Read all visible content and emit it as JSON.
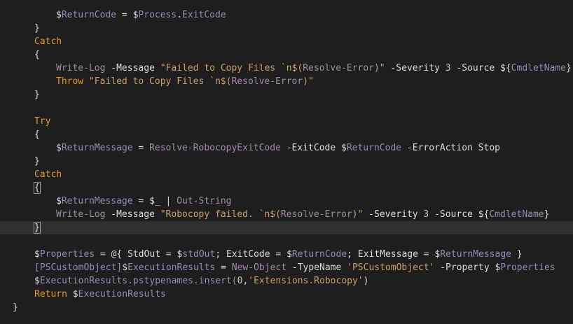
{
  "lines": [
    {
      "indent": 80,
      "tokens": [
        {
          "t": "$",
          "c": "pl"
        },
        {
          "t": "ReturnCode",
          "c": "var"
        },
        {
          "t": " = ",
          "c": "pl"
        },
        {
          "t": "$",
          "c": "pl"
        },
        {
          "t": "Process",
          "c": "var"
        },
        {
          "t": ".",
          "c": "pl"
        },
        {
          "t": "ExitCode",
          "c": "var"
        }
      ]
    },
    {
      "indent": 49,
      "tokens": [
        {
          "t": "}",
          "c": "pl"
        }
      ]
    },
    {
      "indent": 49,
      "tokens": [
        {
          "t": "Catch",
          "c": "kw"
        }
      ]
    },
    {
      "indent": 49,
      "tokens": [
        {
          "t": "{",
          "c": "pl"
        }
      ]
    },
    {
      "indent": 80,
      "tokens": [
        {
          "t": "Write-Log",
          "c": "cmd"
        },
        {
          "t": " -Message ",
          "c": "prm"
        },
        {
          "t": "\"Failed to Copy Files `n$(",
          "c": "str"
        },
        {
          "t": "Resolve-Error",
          "c": "cmd"
        },
        {
          "t": ")\"",
          "c": "str"
        },
        {
          "t": " -Severity ",
          "c": "prm"
        },
        {
          "t": "3",
          "c": "num"
        },
        {
          "t": " -Source ",
          "c": "prm"
        },
        {
          "t": "${",
          "c": "pl"
        },
        {
          "t": "CmdletName",
          "c": "var"
        },
        {
          "t": "}",
          "c": "pl"
        }
      ]
    },
    {
      "indent": 80,
      "tokens": [
        {
          "t": "Throw",
          "c": "kw"
        },
        {
          "t": " \"Failed to Copy Files `n$(",
          "c": "str"
        },
        {
          "t": "Resolve-Error",
          "c": "cmd"
        },
        {
          "t": ")\"",
          "c": "str"
        }
      ]
    },
    {
      "indent": 49,
      "tokens": [
        {
          "t": "}",
          "c": "pl"
        }
      ]
    },
    {
      "indent": 49,
      "tokens": []
    },
    {
      "indent": 49,
      "tokens": [
        {
          "t": "Try",
          "c": "kw"
        }
      ]
    },
    {
      "indent": 49,
      "tokens": [
        {
          "t": "{",
          "c": "pl"
        }
      ]
    },
    {
      "indent": 80,
      "tokens": [
        {
          "t": "$",
          "c": "pl"
        },
        {
          "t": "ReturnMessage",
          "c": "var"
        },
        {
          "t": " = ",
          "c": "pl"
        },
        {
          "t": "Resolve-RobocopyExitCode",
          "c": "cmd"
        },
        {
          "t": " -ExitCode ",
          "c": "prm"
        },
        {
          "t": "$",
          "c": "pl"
        },
        {
          "t": "ReturnCode",
          "c": "var"
        },
        {
          "t": " -ErrorAction Stop",
          "c": "prm"
        }
      ]
    },
    {
      "indent": 49,
      "tokens": [
        {
          "t": "}",
          "c": "pl"
        }
      ]
    },
    {
      "indent": 49,
      "tokens": [
        {
          "t": "Catch",
          "c": "kw"
        }
      ]
    },
    {
      "indent": 49,
      "tokens": [
        {
          "t": "{",
          "c": "pl",
          "box": true
        }
      ]
    },
    {
      "indent": 80,
      "tokens": [
        {
          "t": "$",
          "c": "pl"
        },
        {
          "t": "ReturnMessage",
          "c": "var"
        },
        {
          "t": " = ",
          "c": "pl"
        },
        {
          "t": "$_",
          "c": "pl"
        },
        {
          "t": " | ",
          "c": "pl"
        },
        {
          "t": "Out-String",
          "c": "cmd"
        }
      ]
    },
    {
      "indent": 80,
      "tokens": [
        {
          "t": "Write-Log",
          "c": "cmd"
        },
        {
          "t": " -Message ",
          "c": "prm"
        },
        {
          "t": "\"Robocopy failed. `n$(",
          "c": "str"
        },
        {
          "t": "Resolve-Error",
          "c": "cmd"
        },
        {
          "t": ")\"",
          "c": "str"
        },
        {
          "t": " -Severity ",
          "c": "prm"
        },
        {
          "t": "3",
          "c": "num"
        },
        {
          "t": " -Source ",
          "c": "prm"
        },
        {
          "t": "${",
          "c": "pl"
        },
        {
          "t": "CmdletName",
          "c": "var"
        },
        {
          "t": "}",
          "c": "pl"
        }
      ]
    },
    {
      "indent": 49,
      "current": true,
      "tokens": [
        {
          "t": "}",
          "c": "pl",
          "box": true
        }
      ]
    },
    {
      "indent": 49,
      "tokens": []
    },
    {
      "indent": 49,
      "tokens": [
        {
          "t": "$",
          "c": "pl"
        },
        {
          "t": "Properties",
          "c": "var"
        },
        {
          "t": " = ",
          "c": "pl"
        },
        {
          "t": "@{ StdOut = ",
          "c": "pl"
        },
        {
          "t": "$",
          "c": "pl"
        },
        {
          "t": "stdOut",
          "c": "var"
        },
        {
          "t": "; ExitCode = ",
          "c": "pl"
        },
        {
          "t": "$",
          "c": "pl"
        },
        {
          "t": "ReturnCode",
          "c": "var"
        },
        {
          "t": "; ExitMessage = ",
          "c": "pl"
        },
        {
          "t": "$",
          "c": "pl"
        },
        {
          "t": "ReturnMessage",
          "c": "var"
        },
        {
          "t": " }",
          "c": "pl"
        }
      ]
    },
    {
      "indent": 49,
      "tokens": [
        {
          "t": "[PSCustomObject]",
          "c": "var"
        },
        {
          "t": "$",
          "c": "pl"
        },
        {
          "t": "ExecutionResults",
          "c": "var"
        },
        {
          "t": " = ",
          "c": "pl"
        },
        {
          "t": "New-Object",
          "c": "cmd"
        },
        {
          "t": " -TypeName ",
          "c": "prm"
        },
        {
          "t": "'PSCustomObject'",
          "c": "str"
        },
        {
          "t": " -Property ",
          "c": "prm"
        },
        {
          "t": "$",
          "c": "pl"
        },
        {
          "t": "Properties",
          "c": "var"
        }
      ]
    },
    {
      "indent": 49,
      "tokens": [
        {
          "t": "$",
          "c": "pl"
        },
        {
          "t": "ExecutionResults",
          "c": "var"
        },
        {
          "t": ".pstypenames.insert(",
          "c": "var"
        },
        {
          "t": "0",
          "c": "num"
        },
        {
          "t": ",",
          "c": "pl"
        },
        {
          "t": "'Extensions.Robocopy'",
          "c": "str"
        },
        {
          "t": ")",
          "c": "pl"
        }
      ]
    },
    {
      "indent": 49,
      "tokens": [
        {
          "t": "Return",
          "c": "kw"
        },
        {
          "t": " ",
          "c": "pl"
        },
        {
          "t": "$",
          "c": "pl"
        },
        {
          "t": "ExecutionResults",
          "c": "var"
        }
      ]
    },
    {
      "indent": 18,
      "tokens": [
        {
          "t": "}",
          "c": "pl"
        }
      ]
    }
  ]
}
